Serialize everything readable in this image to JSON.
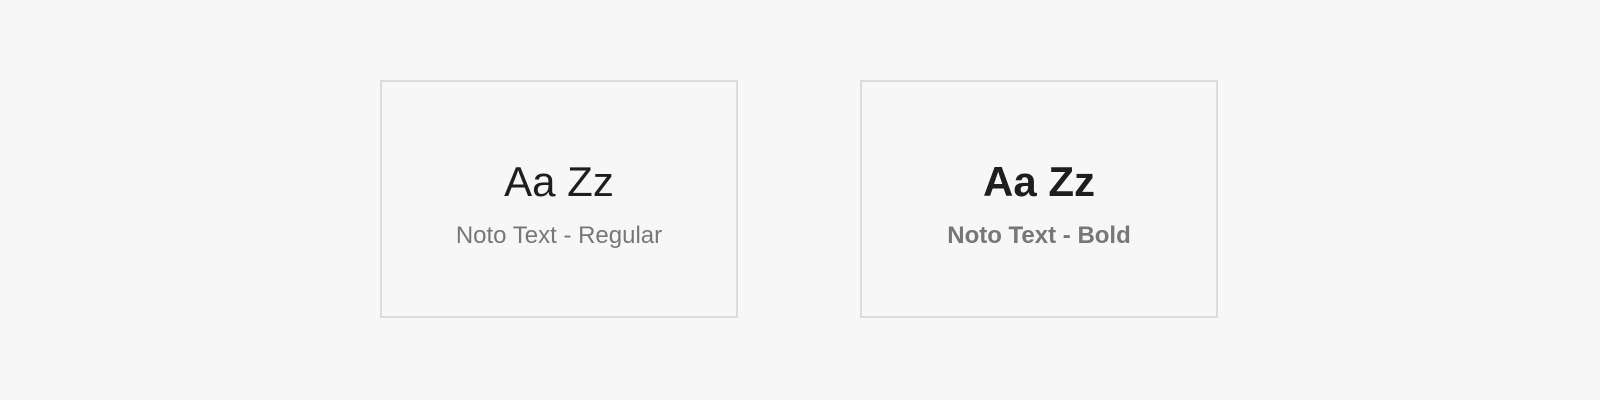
{
  "cards": [
    {
      "sample_text": "Aa Zz",
      "label": "Noto Text - Regular"
    },
    {
      "sample_text": "Aa Zz",
      "label": "Noto Text - Bold"
    }
  ],
  "colors": {
    "background": "#f7f7f7",
    "border": "#dcdcdc",
    "sample_text": "#1e1e1e",
    "label_text": "#777777"
  }
}
